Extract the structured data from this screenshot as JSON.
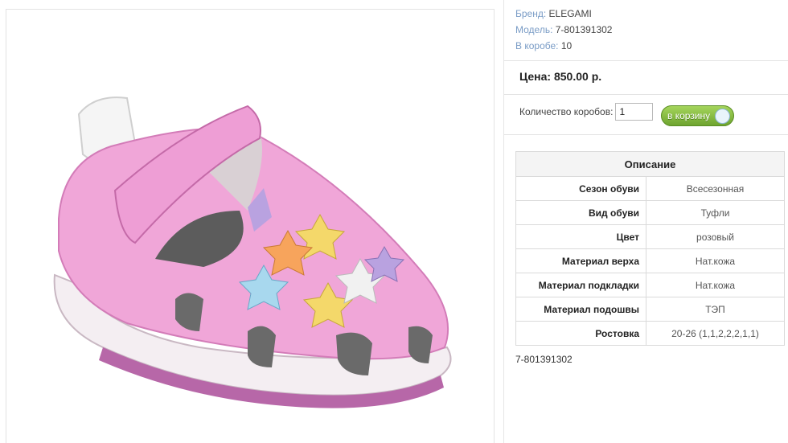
{
  "product": {
    "brand_label": "Бренд:",
    "brand_value": "ELEGAMI",
    "model_label": "Модель:",
    "model_value": "7-801391302",
    "box_label": "В коробе:",
    "box_value": "10",
    "price_label": "Цена:",
    "price_value": "850.00 р.",
    "sku": "7-801391302"
  },
  "cart": {
    "qty_label": "Количество коробов:",
    "qty_value": "1",
    "button_label": "в корзину",
    "button_color": "#7bb33a"
  },
  "description": {
    "title": "Описание",
    "rows": [
      {
        "key": "Сезон обуви",
        "value": "Всесезонная"
      },
      {
        "key": "Вид обуви",
        "value": "Туфли"
      },
      {
        "key": "Цвет",
        "value": "розовый"
      },
      {
        "key": "Материал верха",
        "value": "Нат.кожа"
      },
      {
        "key": "Материал подкладки",
        "value": "Нат.кожа"
      },
      {
        "key": "Материал подошвы",
        "value": "ТЭП"
      },
      {
        "key": "Ростовка",
        "value": "20-26 (1,1,2,2,2,1,1)"
      }
    ]
  },
  "image": {
    "icon": "pink-sandal-photo",
    "shoe_color": "#f0a6d8",
    "sole_color": "#f7f2f5"
  }
}
